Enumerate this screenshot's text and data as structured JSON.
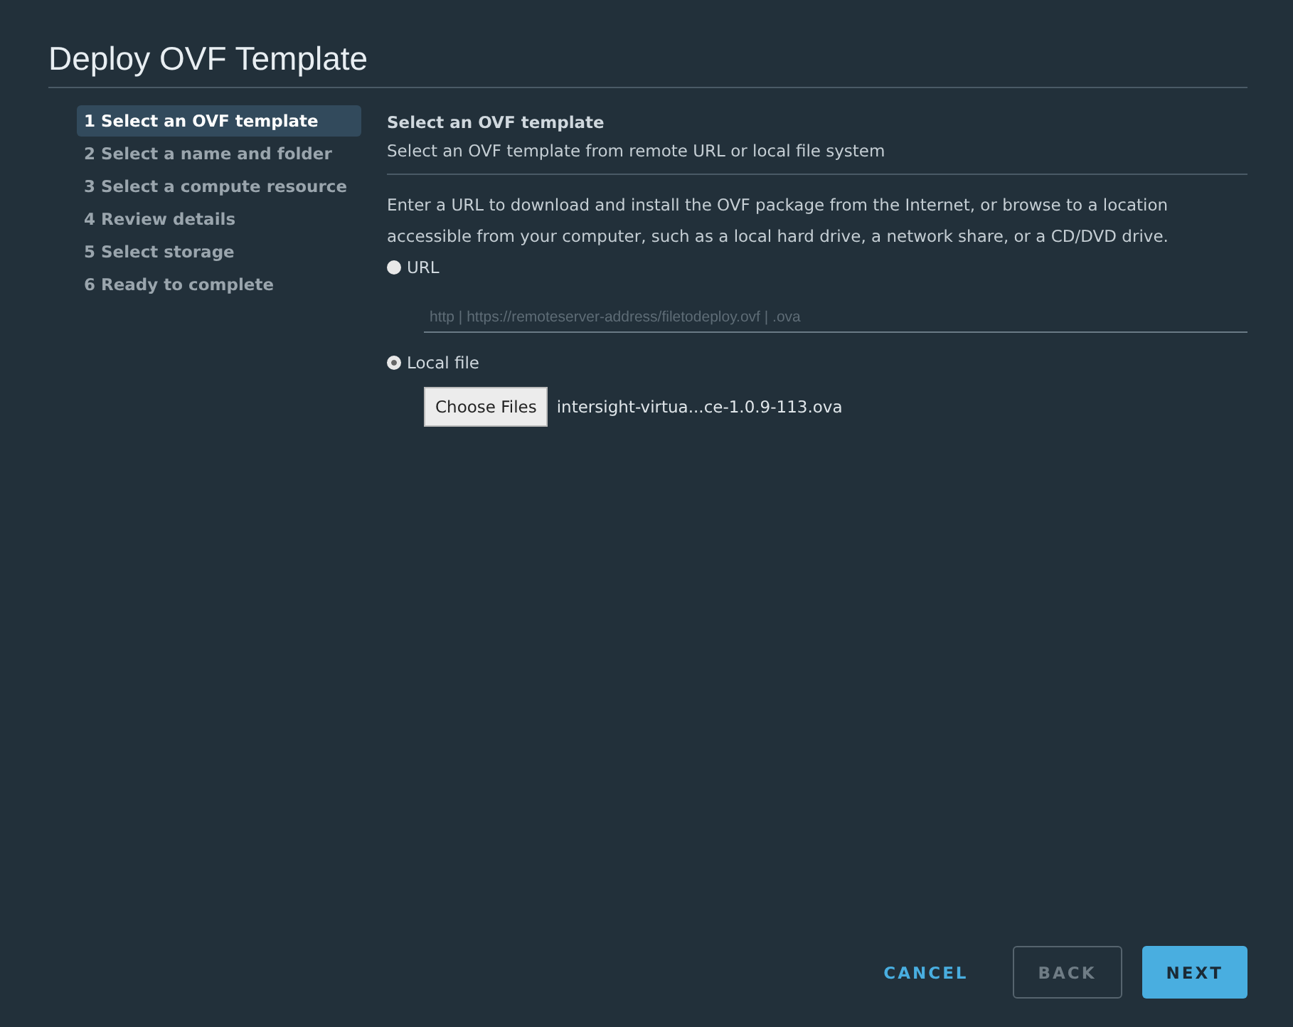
{
  "window": {
    "title": "Deploy OVF Template"
  },
  "steps": [
    {
      "label": "1 Select an OVF template",
      "selected": true
    },
    {
      "label": "2 Select a name and folder",
      "selected": false
    },
    {
      "label": "3 Select a compute resource",
      "selected": false
    },
    {
      "label": "4 Review details",
      "selected": false
    },
    {
      "label": "5 Select storage",
      "selected": false
    },
    {
      "label": "6 Ready to complete",
      "selected": false
    }
  ],
  "content": {
    "heading": "Select an OVF template",
    "subheading": "Select an OVF template from remote URL or local file system",
    "description": "Enter a URL to download and install the OVF package from the Internet, or browse to a location accessible from your computer, such as a local hard drive, a network share, or a CD/DVD drive.",
    "sources": [
      {
        "label": "URL",
        "selected": false,
        "kind": "url",
        "placeholder": "http | https://remoteserver-address/filetodeploy.ovf | .ova"
      },
      {
        "label": "Local file",
        "selected": true,
        "kind": "file",
        "button": "Choose Files",
        "file_name": "intersight-virtua...ce-1.0.9-113.ova"
      }
    ]
  },
  "buttons": [
    {
      "label": "CANCEL",
      "kind": "link",
      "disabled": false
    },
    {
      "label": "BACK",
      "kind": "outline",
      "disabled": true
    },
    {
      "label": "NEXT",
      "kind": "primary",
      "disabled": false
    }
  ]
}
